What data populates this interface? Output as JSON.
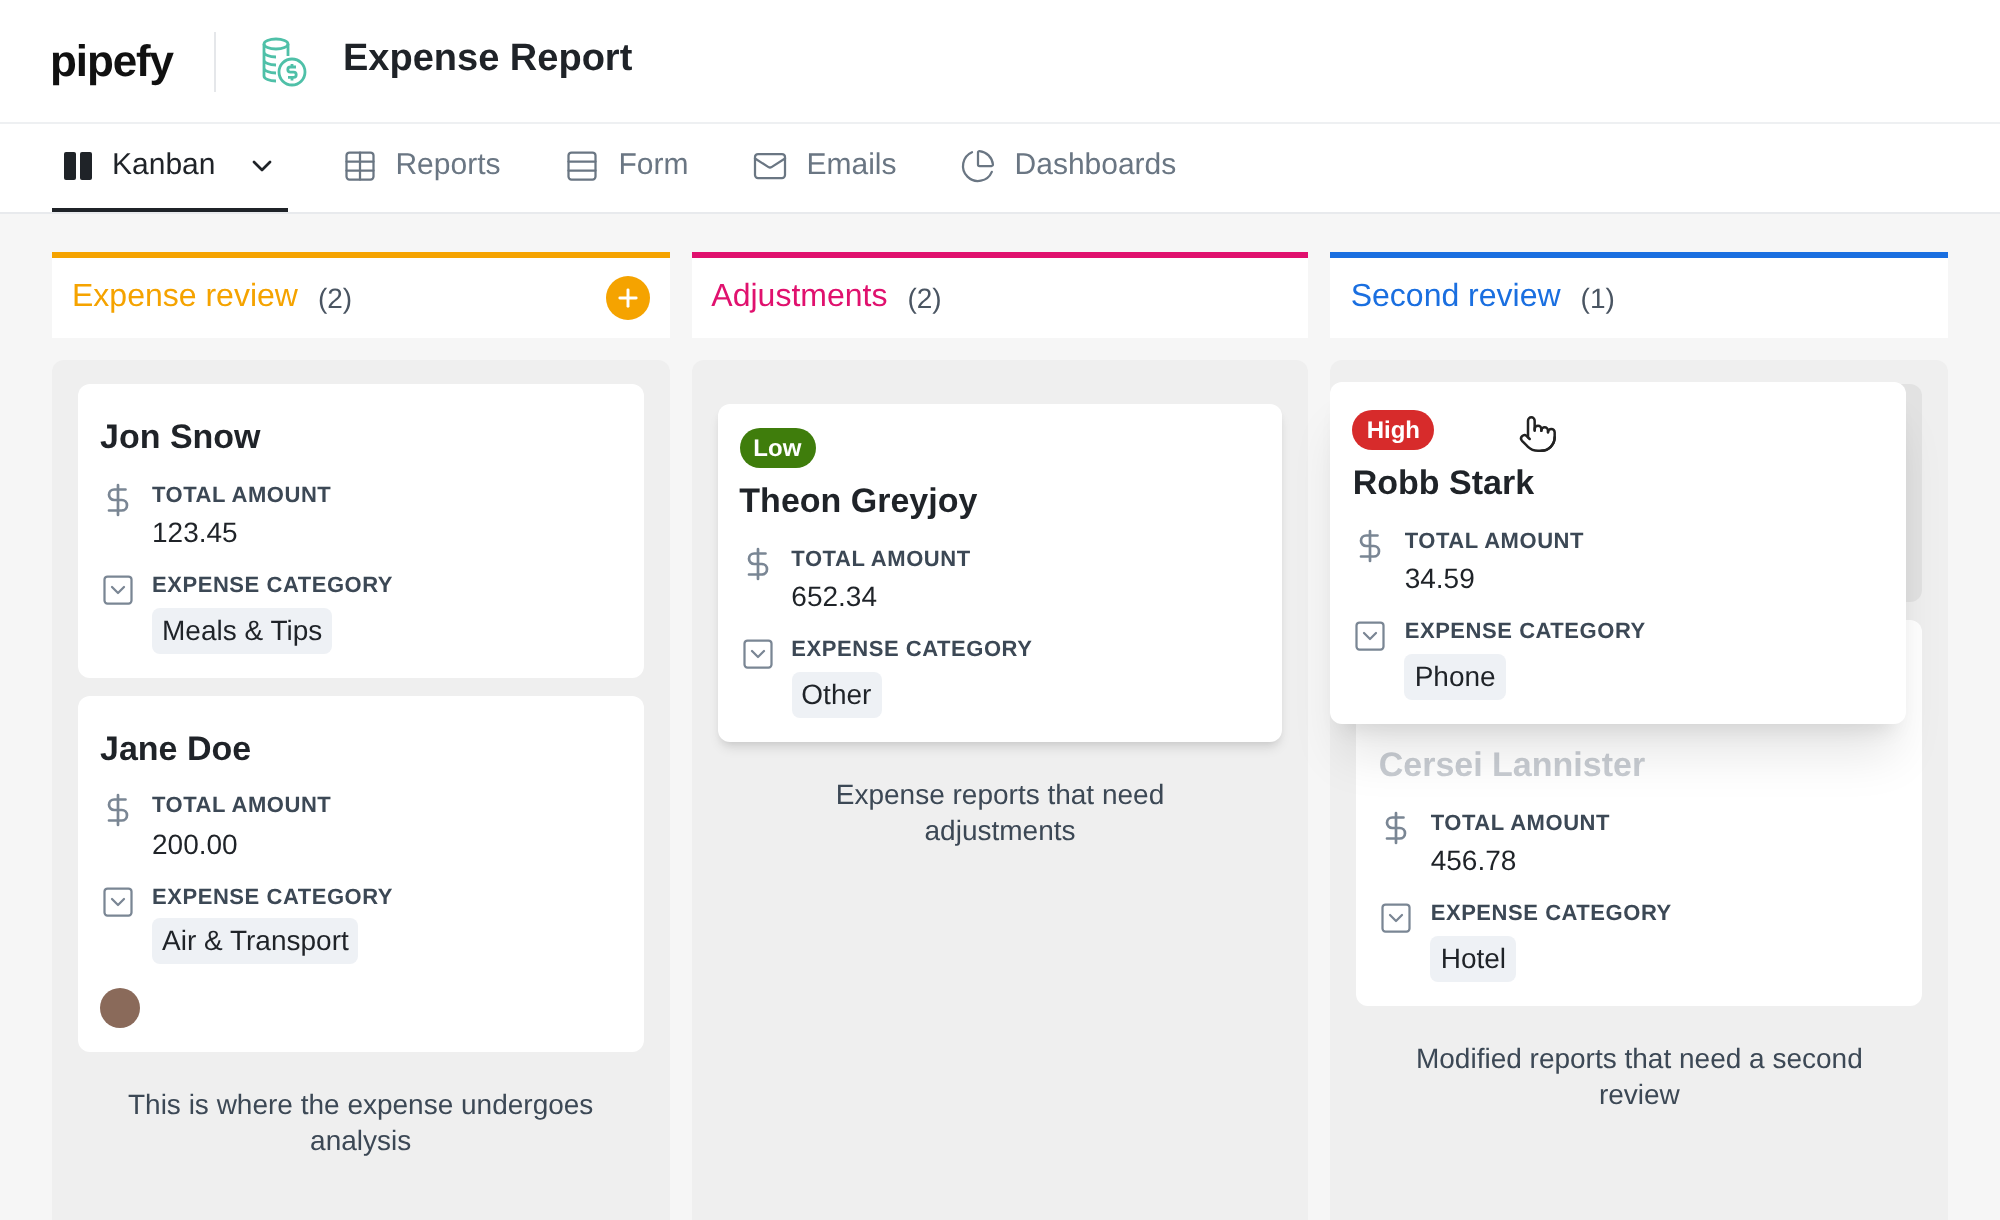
{
  "header": {
    "logo": "pipefy",
    "title": "Expense Report"
  },
  "tabs": [
    {
      "label": "Kanban",
      "kind": "kanban",
      "selected": true,
      "dropdown": true
    },
    {
      "label": "Reports",
      "kind": "table",
      "selected": false
    },
    {
      "label": "Form",
      "kind": "form",
      "selected": false
    },
    {
      "label": "Emails",
      "kind": "mail",
      "selected": false
    },
    {
      "label": "Dashboards",
      "kind": "pie",
      "selected": false
    }
  ],
  "columns": [
    {
      "title": "Expense review",
      "count": "(2)",
      "color": "#f5a300",
      "add_button": true,
      "description": "This is where the expense undergoes analysis",
      "cards": [
        {
          "name": "Jon Snow",
          "name_faded": false,
          "fields": [
            {
              "kind": "currency",
              "label": "TOTAL AMOUNT",
              "value": "123.45"
            },
            {
              "kind": "select",
              "label": "EXPENSE CATEGORY",
              "value": "Meals & Tips"
            }
          ]
        },
        {
          "name": "Jane Doe",
          "name_faded": false,
          "avatar": true,
          "fields": [
            {
              "kind": "currency",
              "label": "TOTAL AMOUNT",
              "value": "200.00"
            },
            {
              "kind": "select",
              "label": "EXPENSE CATEGORY",
              "value": "Air & Transport"
            }
          ]
        }
      ]
    },
    {
      "title": "Adjustments",
      "count": "(2)",
      "color": "#e0116e",
      "description": "Expense reports that need adjustments",
      "cards": [
        {
          "name": "Theon Greyjoy",
          "name_faded": false,
          "priority": {
            "label": "Low",
            "color": "#3f7d0c"
          },
          "fields": [
            {
              "kind": "currency",
              "label": "TOTAL AMOUNT",
              "value": "652.34"
            },
            {
              "kind": "select",
              "label": "EXPENSE CATEGORY",
              "value": "Other"
            }
          ]
        }
      ]
    },
    {
      "title": "Second review",
      "count": "(1)",
      "color": "#1a6fe0",
      "description": "Modified reports that need a second review",
      "drop_placeholder": true,
      "dragged_card": {
        "name": "Robb Stark",
        "name_faded": false,
        "priority": {
          "label": "High",
          "color": "#d72b2b"
        },
        "fields": [
          {
            "kind": "currency",
            "label": "TOTAL AMOUNT",
            "value": "34.59"
          },
          {
            "kind": "select",
            "label": "EXPENSE CATEGORY",
            "value": "Phone"
          }
        ]
      },
      "cards": [
        {
          "name": "Cersei Lannister",
          "name_faded": true,
          "fields": [
            {
              "kind": "currency",
              "label": "TOTAL AMOUNT",
              "value": "456.78"
            },
            {
              "kind": "select",
              "label": "EXPENSE CATEGORY",
              "value": "Hotel"
            }
          ]
        }
      ]
    }
  ]
}
